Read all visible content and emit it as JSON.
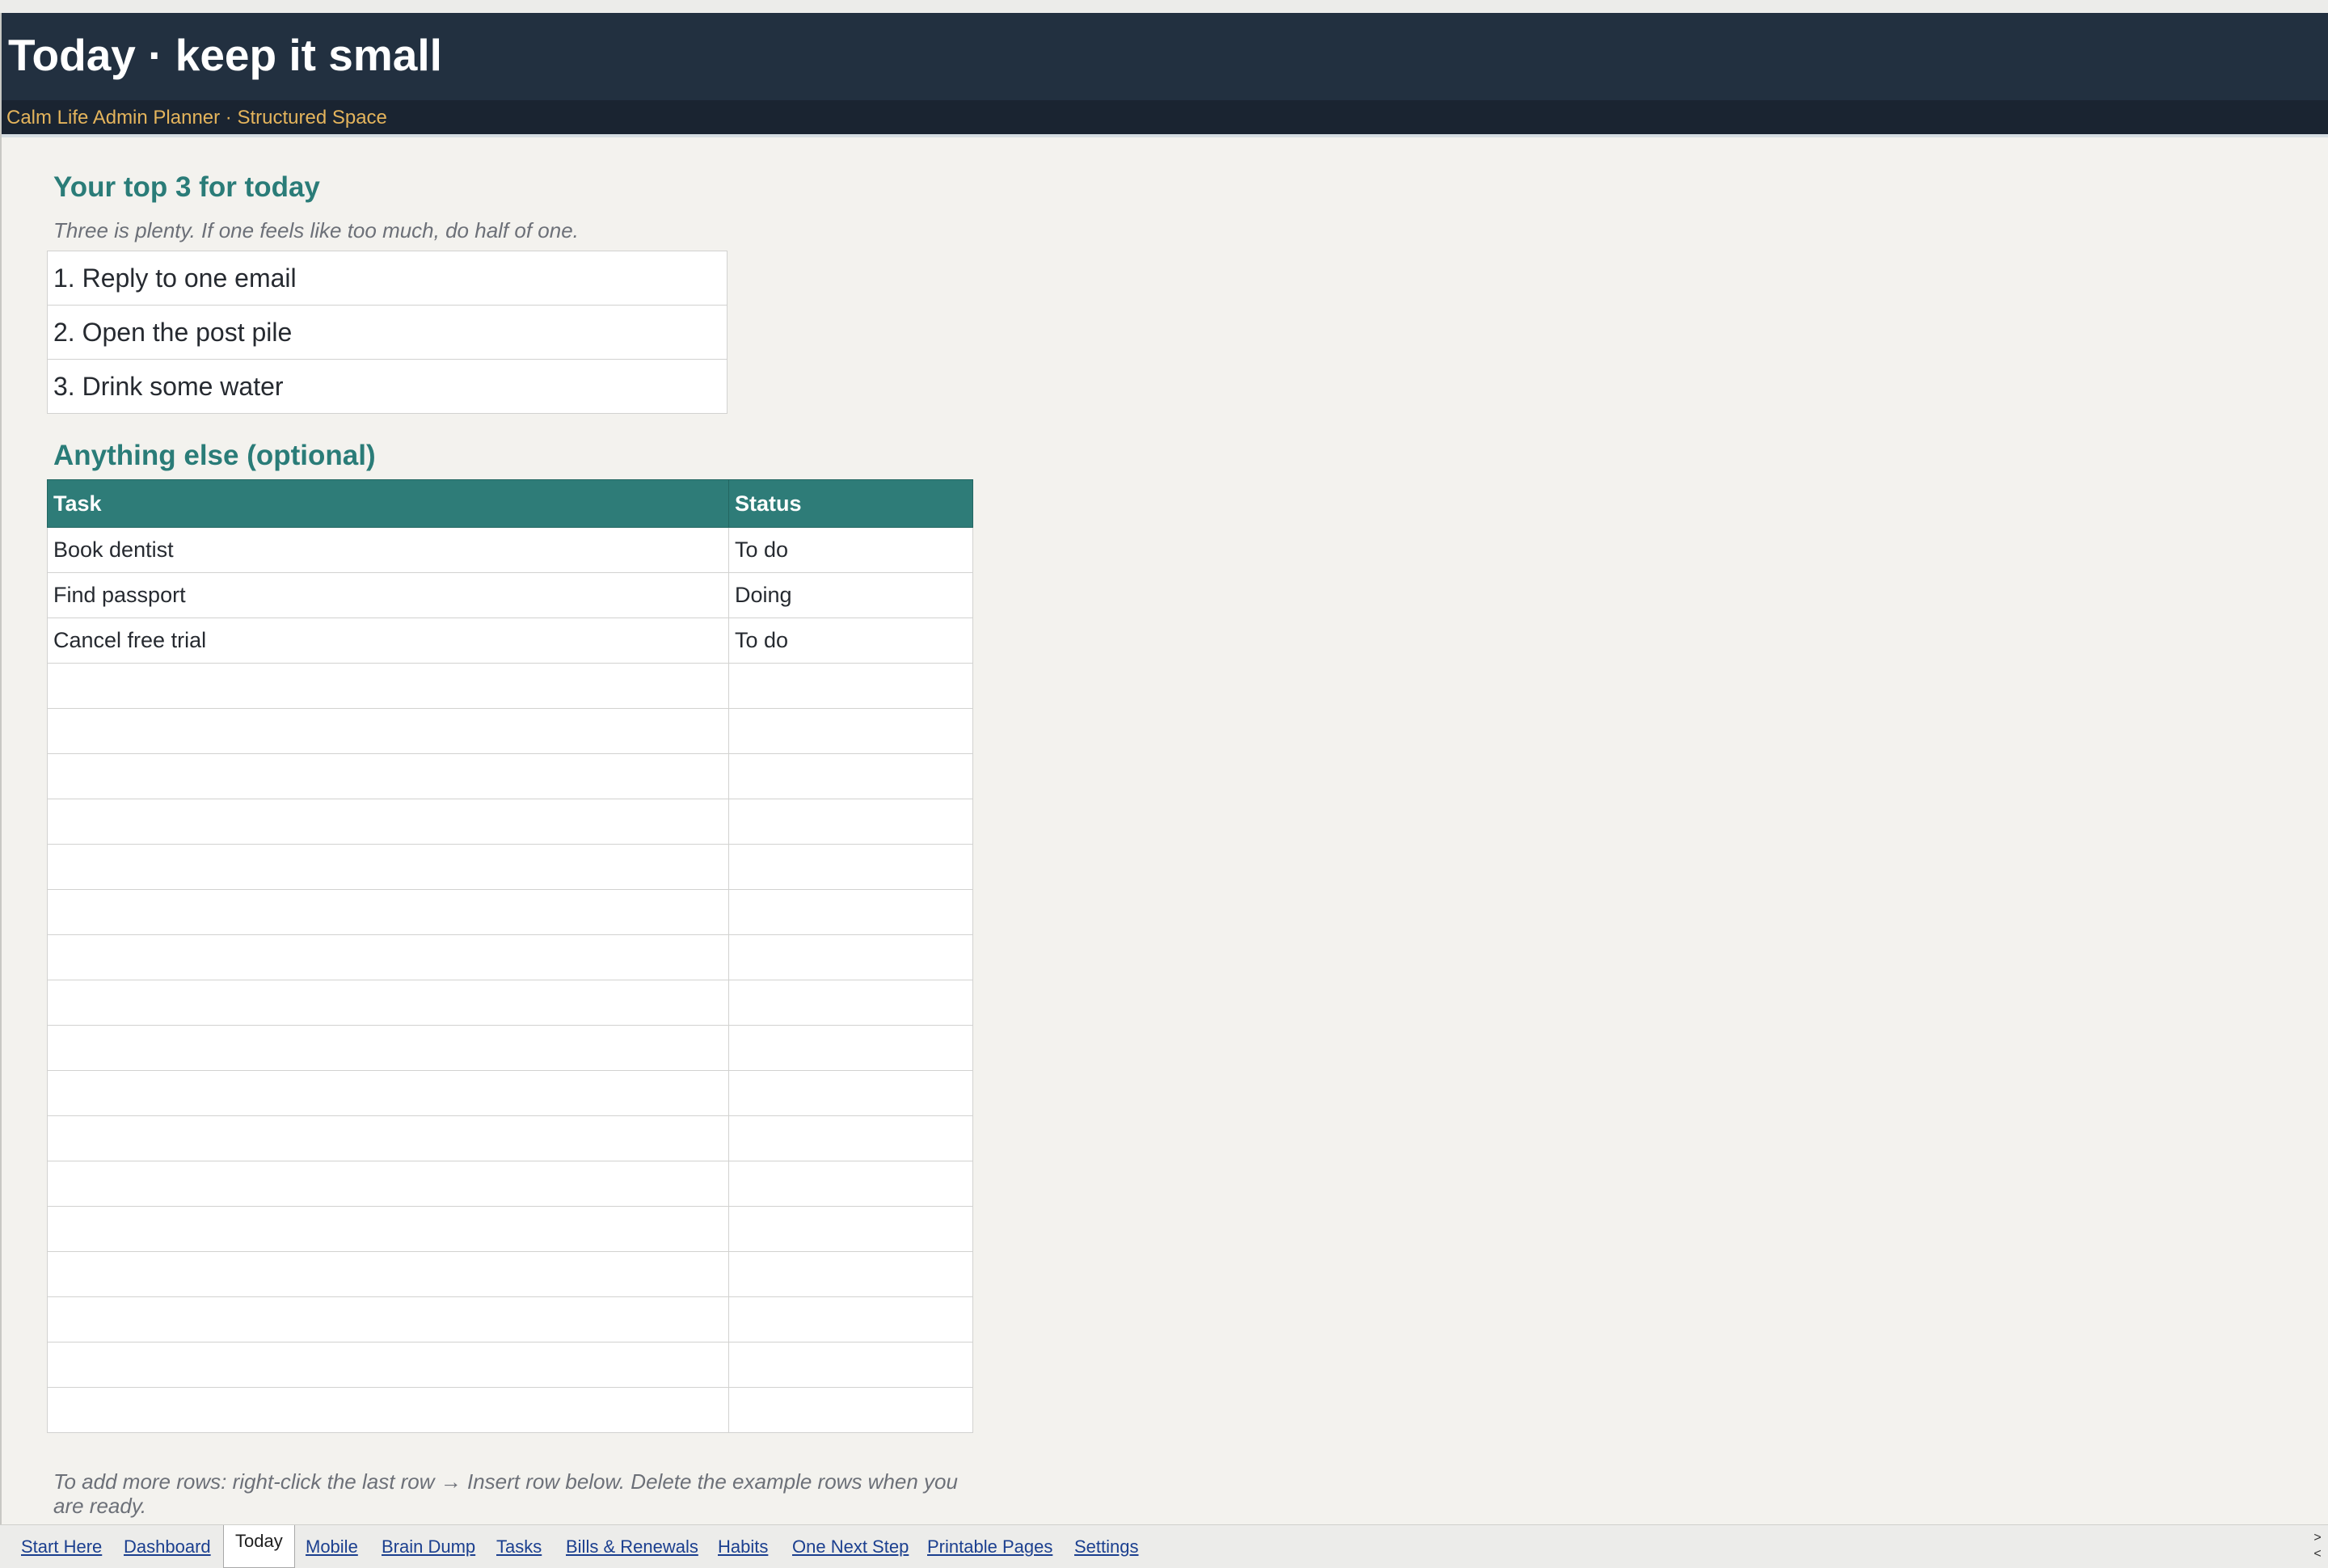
{
  "header": {
    "title": "Today · keep it small",
    "subtitle": "Calm Life Admin Planner · Structured Space"
  },
  "top3": {
    "heading": "Your top 3 for today",
    "hint": "Three is plenty. If one feels like too much, do half of one.",
    "items": [
      "1. Reply to one email",
      "2. Open the post pile",
      "3. Drink some water"
    ]
  },
  "optional": {
    "heading": "Anything else (optional)",
    "columns": [
      "Task",
      "Status"
    ],
    "rows": [
      {
        "task": "Book dentist",
        "status": "To do"
      },
      {
        "task": "Find passport",
        "status": "Doing"
      },
      {
        "task": "Cancel free trial",
        "status": "To do"
      },
      {
        "task": "",
        "status": ""
      },
      {
        "task": "",
        "status": ""
      },
      {
        "task": "",
        "status": ""
      },
      {
        "task": "",
        "status": ""
      },
      {
        "task": "",
        "status": ""
      },
      {
        "task": "",
        "status": ""
      },
      {
        "task": "",
        "status": ""
      },
      {
        "task": "",
        "status": ""
      },
      {
        "task": "",
        "status": ""
      },
      {
        "task": "",
        "status": ""
      },
      {
        "task": "",
        "status": ""
      },
      {
        "task": "",
        "status": ""
      },
      {
        "task": "",
        "status": ""
      },
      {
        "task": "",
        "status": ""
      },
      {
        "task": "",
        "status": ""
      },
      {
        "task": "",
        "status": ""
      },
      {
        "task": "",
        "status": ""
      }
    ],
    "footnote": "To add more rows: right-click the last row → Insert row below. Delete the example rows when you are ready."
  },
  "tabs": [
    {
      "label": "Start Here",
      "active": false
    },
    {
      "label": "Dashboard",
      "active": false
    },
    {
      "label": "Today",
      "active": true
    },
    {
      "label": "Mobile",
      "active": false
    },
    {
      "label": "Brain Dump",
      "active": false
    },
    {
      "label": "Tasks",
      "active": false
    },
    {
      "label": "Bills & Renewals",
      "active": false
    },
    {
      "label": "Habits",
      "active": false
    },
    {
      "label": "One Next Step",
      "active": false
    },
    {
      "label": "Printable Pages",
      "active": false
    },
    {
      "label": "Settings",
      "active": false
    }
  ],
  "scroll_arrows": {
    "right": ">",
    "left": "<"
  }
}
